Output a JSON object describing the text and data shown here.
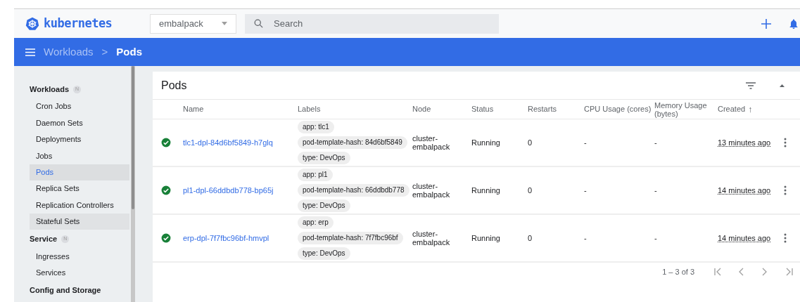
{
  "header": {
    "logo": "kubernetes",
    "namespace": "embalpack",
    "search": {
      "placeholder": "Search"
    }
  },
  "breadcrumb": {
    "parent": "Workloads",
    "separator": ">",
    "current": "Pods"
  },
  "sidebar": {
    "sections": [
      {
        "title": "Workloads",
        "badge": "N",
        "items": [
          {
            "label": "Cron Jobs",
            "selected": false,
            "hovered": false
          },
          {
            "label": "Daemon Sets",
            "selected": false,
            "hovered": false
          },
          {
            "label": "Deployments",
            "selected": false,
            "hovered": false
          },
          {
            "label": "Jobs",
            "selected": false,
            "hovered": false
          },
          {
            "label": "Pods",
            "selected": true,
            "hovered": false
          },
          {
            "label": "Replica Sets",
            "selected": false,
            "hovered": false
          },
          {
            "label": "Replication Controllers",
            "selected": false,
            "hovered": false
          },
          {
            "label": "Stateful Sets",
            "selected": false,
            "hovered": true
          }
        ]
      },
      {
        "title": "Service",
        "badge": "N",
        "items": [
          {
            "label": "Ingresses",
            "selected": false,
            "hovered": false
          },
          {
            "label": "Services",
            "selected": false,
            "hovered": false
          }
        ]
      },
      {
        "title": "Config and Storage"
      }
    ]
  },
  "card": {
    "title": "Pods",
    "table": {
      "columns": [
        {
          "label": "Name",
          "sorted": false
        },
        {
          "label": "Labels",
          "sorted": false
        },
        {
          "label": "Node",
          "sorted": false
        },
        {
          "label": "Status",
          "sorted": false
        },
        {
          "label": "Restarts",
          "sorted": false
        },
        {
          "label": "CPU Usage (cores)",
          "sorted": false
        },
        {
          "label": "Memory Usage (bytes)",
          "sorted": false
        },
        {
          "label": "Created",
          "sorted": true
        }
      ],
      "sort_arrow": "↑",
      "rows": [
        {
          "color": "#188038",
          "name": "tlc1-dpl-84d6bf5849-h7glq",
          "labels": [
            "app: tlc1",
            "pod-template-hash: 84d6bf5849",
            "type: DevOps"
          ],
          "node": "cluster-embalpack",
          "state": "Running",
          "restarts": "0",
          "cpu": "-",
          "memory": "-",
          "created": "13 minutes ago"
        },
        {
          "color": "#188038",
          "name": "pl1-dpl-66ddbdb778-bp65j",
          "labels": [
            "app: pl1",
            "pod-template-hash: 66ddbdb778",
            "type: DevOps"
          ],
          "node": "cluster-embalpack",
          "state": "Running",
          "restarts": "0",
          "cpu": "-",
          "memory": "-",
          "created": "14 minutes ago"
        },
        {
          "color": "#188038",
          "name": "erp-dpl-7f7fbc96bf-hmvpl",
          "labels": [
            "app: erp",
            "pod-template-hash: 7f7fbc96bf",
            "type: DevOps"
          ],
          "node": "cluster-embalpack",
          "state": "Running",
          "restarts": "0",
          "cpu": "-",
          "memory": "-",
          "created": "14 minutes ago"
        }
      ]
    },
    "pagination": "1 – 3 of 3"
  }
}
